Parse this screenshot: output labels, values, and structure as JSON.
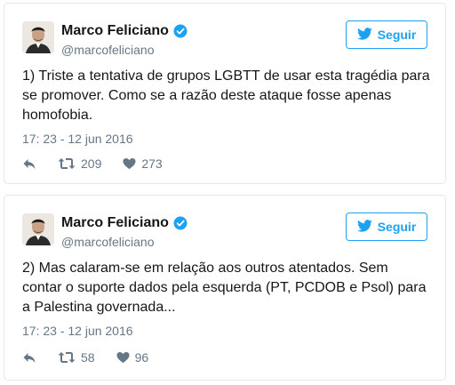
{
  "colors": {
    "accent": "#1da1f2",
    "muted": "#657786",
    "border": "#e1e8ed"
  },
  "tweets": [
    {
      "name": "Marco Feliciano",
      "handle": "@marcofeliciano",
      "follow_label": "Seguir",
      "text": "1) Triste a tentativa de grupos LGBTT de usar esta tragédia para se promover. Como se a razão deste ataque fosse apenas homofobia.",
      "timestamp": "17: 23 - 12 jun 2016",
      "retweets": "209",
      "likes": "273"
    },
    {
      "name": "Marco Feliciano",
      "handle": "@marcofeliciano",
      "follow_label": "Seguir",
      "text": "2) Mas calaram-se em relação aos outros atentados. Sem contar o suporte dados pela esquerda (PT, PCDOB e Psol) para a Palestina governada...",
      "timestamp": "17: 23 - 12 jun 2016",
      "retweets": "58",
      "likes": "96"
    }
  ],
  "icons": [
    "avatar",
    "verified-icon",
    "twitter-bird-icon",
    "reply-icon",
    "retweet-icon",
    "like-icon"
  ]
}
